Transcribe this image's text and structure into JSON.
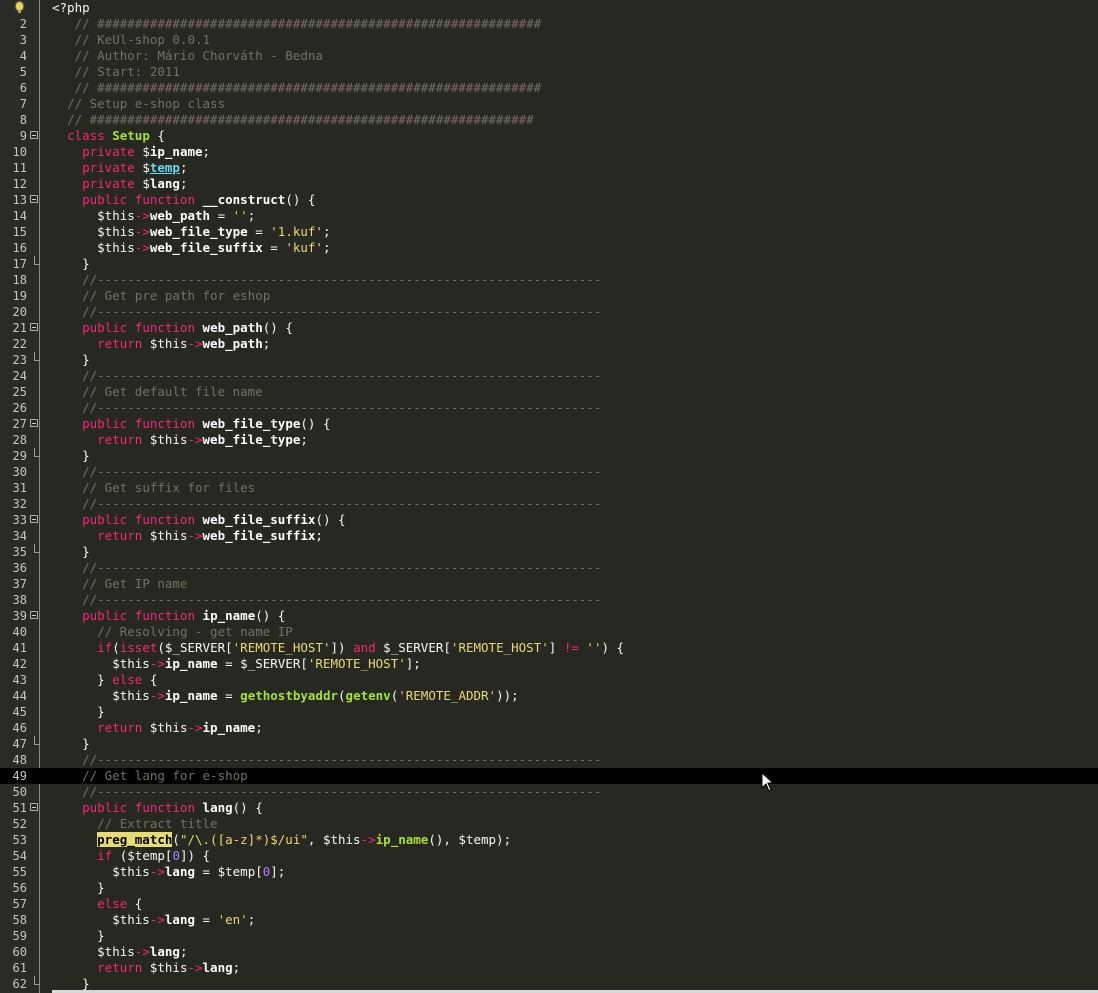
{
  "editor": {
    "language": "php",
    "current_line": 49,
    "lines": [
      [
        [
          "t",
          "<?php"
        ]
      ],
      [
        [
          "t",
          "   "
        ],
        [
          "cm",
          "// ###########################################################"
        ]
      ],
      [
        [
          "t",
          "   "
        ],
        [
          "cm",
          "// KeUl-shop 0.0.1"
        ]
      ],
      [
        [
          "t",
          "   "
        ],
        [
          "cm",
          "// Author: Mário Chorváth - Bedna"
        ]
      ],
      [
        [
          "t",
          "   "
        ],
        [
          "cm",
          "// Start: 2011"
        ]
      ],
      [
        [
          "t",
          "   "
        ],
        [
          "cm",
          "// ###########################################################"
        ]
      ],
      [
        [
          "t",
          "  "
        ],
        [
          "cm",
          "// Setup e-shop class"
        ]
      ],
      [
        [
          "t",
          "  "
        ],
        [
          "cm",
          "// ###########################################################"
        ]
      ],
      [
        [
          "t",
          "  "
        ],
        [
          "kw",
          "class"
        ],
        [
          "t",
          " "
        ],
        [
          "cl",
          "Setup"
        ],
        [
          "t",
          " {"
        ]
      ],
      [
        [
          "t",
          "    "
        ],
        [
          "kw",
          "private"
        ],
        [
          "t",
          " $"
        ],
        [
          "pr",
          "ip_name"
        ],
        [
          "t",
          ";"
        ]
      ],
      [
        [
          "t",
          "    "
        ],
        [
          "kw",
          "private"
        ],
        [
          "t",
          " $"
        ],
        [
          "tp",
          "temp"
        ],
        [
          "t",
          ";"
        ]
      ],
      [
        [
          "t",
          "    "
        ],
        [
          "kw",
          "private"
        ],
        [
          "t",
          " $"
        ],
        [
          "pr",
          "lang"
        ],
        [
          "t",
          ";"
        ]
      ],
      [
        [
          "t",
          "    "
        ],
        [
          "kw",
          "public"
        ],
        [
          "t",
          " "
        ],
        [
          "kw",
          "function"
        ],
        [
          "t",
          " "
        ],
        [
          "pr",
          "__construct"
        ],
        [
          "t",
          "() {"
        ]
      ],
      [
        [
          "t",
          "      $this"
        ],
        [
          "ar",
          "->"
        ],
        [
          "pr",
          "web_path"
        ],
        [
          "t",
          " = "
        ],
        [
          "st",
          "''"
        ],
        [
          "t",
          ";"
        ]
      ],
      [
        [
          "t",
          "      $this"
        ],
        [
          "ar",
          "->"
        ],
        [
          "pr",
          "web_file_type"
        ],
        [
          "t",
          " = "
        ],
        [
          "st",
          "'1.kuf'"
        ],
        [
          "t",
          ";"
        ]
      ],
      [
        [
          "t",
          "      $this"
        ],
        [
          "ar",
          "->"
        ],
        [
          "pr",
          "web_file_suffix"
        ],
        [
          "t",
          " = "
        ],
        [
          "st",
          "'kuf'"
        ],
        [
          "t",
          ";"
        ]
      ],
      [
        [
          "t",
          "    }"
        ]
      ],
      [
        [
          "t",
          "    "
        ],
        [
          "cm",
          "//-------------------------------------------------------------------"
        ]
      ],
      [
        [
          "t",
          "    "
        ],
        [
          "cm",
          "// Get pre path for eshop"
        ]
      ],
      [
        [
          "t",
          "    "
        ],
        [
          "cm",
          "//-------------------------------------------------------------------"
        ]
      ],
      [
        [
          "t",
          "    "
        ],
        [
          "kw",
          "public"
        ],
        [
          "t",
          " "
        ],
        [
          "kw",
          "function"
        ],
        [
          "t",
          " "
        ],
        [
          "pr",
          "web_path"
        ],
        [
          "t",
          "() {"
        ]
      ],
      [
        [
          "t",
          "      "
        ],
        [
          "kw",
          "return"
        ],
        [
          "t",
          " $this"
        ],
        [
          "ar",
          "->"
        ],
        [
          "pr",
          "web_path"
        ],
        [
          "t",
          ";"
        ]
      ],
      [
        [
          "t",
          "    }"
        ]
      ],
      [
        [
          "t",
          "    "
        ],
        [
          "cm",
          "//-------------------------------------------------------------------"
        ]
      ],
      [
        [
          "t",
          "    "
        ],
        [
          "cm",
          "// Get default file name"
        ]
      ],
      [
        [
          "t",
          "    "
        ],
        [
          "cm",
          "//-------------------------------------------------------------------"
        ]
      ],
      [
        [
          "t",
          "    "
        ],
        [
          "kw",
          "public"
        ],
        [
          "t",
          " "
        ],
        [
          "kw",
          "function"
        ],
        [
          "t",
          " "
        ],
        [
          "pr",
          "web_file_type"
        ],
        [
          "t",
          "() {"
        ]
      ],
      [
        [
          "t",
          "      "
        ],
        [
          "kw",
          "return"
        ],
        [
          "t",
          " $this"
        ],
        [
          "ar",
          "->"
        ],
        [
          "pr",
          "web_file_type"
        ],
        [
          "t",
          ";"
        ]
      ],
      [
        [
          "t",
          "    }"
        ]
      ],
      [
        [
          "t",
          "    "
        ],
        [
          "cm",
          "//-------------------------------------------------------------------"
        ]
      ],
      [
        [
          "t",
          "    "
        ],
        [
          "cm",
          "// Get suffix for files"
        ]
      ],
      [
        [
          "t",
          "    "
        ],
        [
          "cm",
          "//-------------------------------------------------------------------"
        ]
      ],
      [
        [
          "t",
          "    "
        ],
        [
          "kw",
          "public"
        ],
        [
          "t",
          " "
        ],
        [
          "kw",
          "function"
        ],
        [
          "t",
          " "
        ],
        [
          "pr",
          "web_file_suffix"
        ],
        [
          "t",
          "() {"
        ]
      ],
      [
        [
          "t",
          "      "
        ],
        [
          "kw",
          "return"
        ],
        [
          "t",
          " $this"
        ],
        [
          "ar",
          "->"
        ],
        [
          "pr",
          "web_file_suffix"
        ],
        [
          "t",
          ";"
        ]
      ],
      [
        [
          "t",
          "    }"
        ]
      ],
      [
        [
          "t",
          "    "
        ],
        [
          "cm",
          "//-------------------------------------------------------------------"
        ]
      ],
      [
        [
          "t",
          "    "
        ],
        [
          "cm",
          "// Get IP name"
        ]
      ],
      [
        [
          "t",
          "    "
        ],
        [
          "cm",
          "//-------------------------------------------------------------------"
        ]
      ],
      [
        [
          "t",
          "    "
        ],
        [
          "kw",
          "public"
        ],
        [
          "t",
          " "
        ],
        [
          "kw",
          "function"
        ],
        [
          "t",
          " "
        ],
        [
          "pr",
          "ip_name"
        ],
        [
          "t",
          "() {"
        ]
      ],
      [
        [
          "t",
          "      "
        ],
        [
          "cm",
          "// Resolving - get name IP"
        ]
      ],
      [
        [
          "t",
          "      "
        ],
        [
          "kw",
          "if"
        ],
        [
          "t",
          "("
        ],
        [
          "kw",
          "isset"
        ],
        [
          "t",
          "($_SERVER["
        ],
        [
          "st",
          "'REMOTE_HOST'"
        ],
        [
          "t",
          "]) "
        ],
        [
          "kw",
          "and"
        ],
        [
          "t",
          " $_SERVER["
        ],
        [
          "st",
          "'REMOTE_HOST'"
        ],
        [
          "t",
          "] "
        ],
        [
          "kw",
          "!="
        ],
        [
          "t",
          " "
        ],
        [
          "st",
          "''"
        ],
        [
          "t",
          ") {"
        ]
      ],
      [
        [
          "t",
          "        $this"
        ],
        [
          "ar",
          "->"
        ],
        [
          "pr",
          "ip_name"
        ],
        [
          "t",
          " = $_SERVER["
        ],
        [
          "st",
          "'REMOTE_HOST'"
        ],
        [
          "t",
          "];"
        ]
      ],
      [
        [
          "t",
          "      } "
        ],
        [
          "kw",
          "else"
        ],
        [
          "t",
          " {"
        ]
      ],
      [
        [
          "t",
          "        $this"
        ],
        [
          "ar",
          "->"
        ],
        [
          "pr",
          "ip_name"
        ],
        [
          "t",
          " = "
        ],
        [
          "fn",
          "gethostbyaddr"
        ],
        [
          "t",
          "("
        ],
        [
          "fn",
          "getenv"
        ],
        [
          "t",
          "("
        ],
        [
          "st",
          "'REMOTE_ADDR'"
        ],
        [
          "t",
          "));"
        ]
      ],
      [
        [
          "t",
          "      }"
        ]
      ],
      [
        [
          "t",
          "      "
        ],
        [
          "kw",
          "return"
        ],
        [
          "t",
          " $this"
        ],
        [
          "ar",
          "->"
        ],
        [
          "pr",
          "ip_name"
        ],
        [
          "t",
          ";"
        ]
      ],
      [
        [
          "t",
          "    }"
        ]
      ],
      [
        [
          "t",
          "    "
        ],
        [
          "cm",
          "//-------------------------------------------------------------------"
        ]
      ],
      [
        [
          "t",
          "    "
        ],
        [
          "cm",
          "// Get lang for e-shop"
        ]
      ],
      [
        [
          "t",
          "    "
        ],
        [
          "cm",
          "//-------------------------------------------------------------------"
        ]
      ],
      [
        [
          "t",
          "    "
        ],
        [
          "kw",
          "public"
        ],
        [
          "t",
          " "
        ],
        [
          "kw",
          "function"
        ],
        [
          "t",
          " "
        ],
        [
          "pr",
          "lang"
        ],
        [
          "t",
          "() {"
        ]
      ],
      [
        [
          "t",
          "      "
        ],
        [
          "cm",
          "// Extract title"
        ]
      ],
      [
        [
          "t",
          "      "
        ],
        [
          "hl",
          "preg_match"
        ],
        [
          "t",
          "("
        ],
        [
          "st",
          "\"/\\.([a-z]*)$/ui\""
        ],
        [
          "t",
          ", $this"
        ],
        [
          "ar",
          "->"
        ],
        [
          "fn",
          "ip_name"
        ],
        [
          "t",
          "(), $temp);"
        ]
      ],
      [
        [
          "t",
          "      "
        ],
        [
          "kw",
          "if"
        ],
        [
          "t",
          " ($temp["
        ],
        [
          "nm",
          "0"
        ],
        [
          "t",
          "]) {"
        ]
      ],
      [
        [
          "t",
          "        $this"
        ],
        [
          "ar",
          "->"
        ],
        [
          "pr",
          "lang"
        ],
        [
          "t",
          " = $temp["
        ],
        [
          "nm",
          "0"
        ],
        [
          "t",
          "];"
        ]
      ],
      [
        [
          "t",
          "      }"
        ]
      ],
      [
        [
          "t",
          "      "
        ],
        [
          "kw",
          "else"
        ],
        [
          "t",
          " {"
        ]
      ],
      [
        [
          "t",
          "        $this"
        ],
        [
          "ar",
          "->"
        ],
        [
          "pr",
          "lang"
        ],
        [
          "t",
          " = "
        ],
        [
          "st",
          "'en'"
        ],
        [
          "t",
          ";"
        ]
      ],
      [
        [
          "t",
          "      }"
        ]
      ],
      [
        [
          "t",
          "      $this"
        ],
        [
          "ar",
          "->"
        ],
        [
          "pr",
          "lang"
        ],
        [
          "t",
          ";"
        ]
      ],
      [
        [
          "t",
          "      "
        ],
        [
          "kw",
          "return"
        ],
        [
          "t",
          " $this"
        ],
        [
          "ar",
          "->"
        ],
        [
          "pr",
          "lang"
        ],
        [
          "t",
          ";"
        ]
      ],
      [
        [
          "t",
          "    }"
        ]
      ]
    ],
    "fold_start_lines": [
      9,
      13,
      21,
      27,
      33,
      39,
      51
    ],
    "fold_end_lines": [
      17,
      23,
      29,
      35,
      47,
      62
    ],
    "hint_icon": "lightbulb-icon"
  }
}
